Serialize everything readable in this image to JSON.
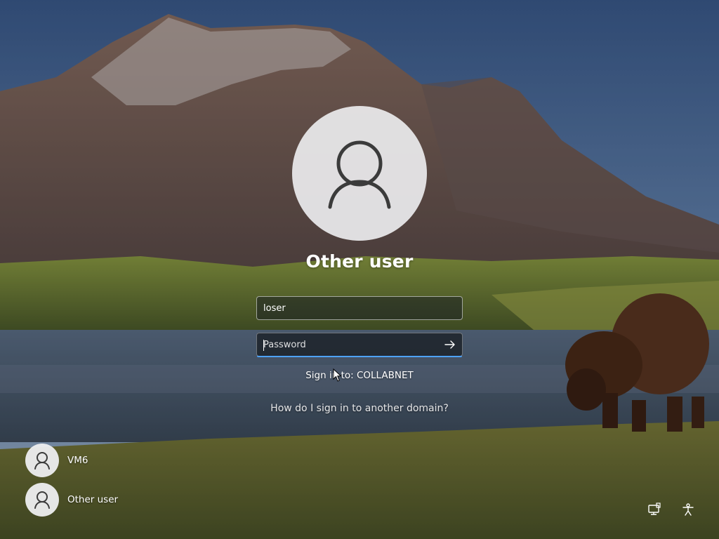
{
  "login": {
    "username": "Other user",
    "username_field_value": "loser",
    "password_placeholder": "Password",
    "sign_in_to": "Sign in to: COLLABNET",
    "domain_help": "How do I sign in to another domain?"
  },
  "users": [
    {
      "name": "VM6",
      "icon": "user-icon"
    },
    {
      "name": "Other user",
      "icon": "user-icon"
    }
  ],
  "bottom_right": {
    "network_icon": "network-icon",
    "accessibility_icon": "accessibility-icon"
  },
  "colors": {
    "focus_accent": "#4da3ff"
  }
}
